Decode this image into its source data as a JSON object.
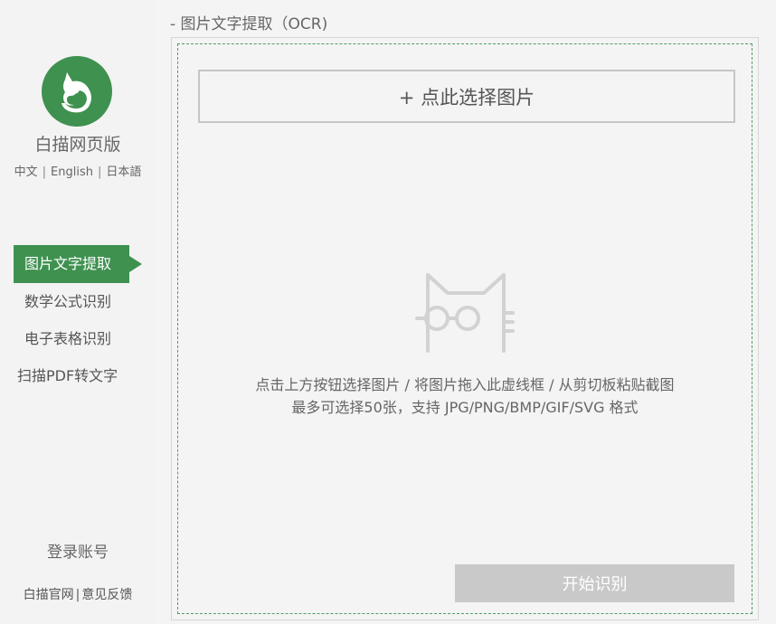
{
  "sidebar": {
    "brand": "白描网页版",
    "languages": [
      "中文",
      "English",
      "日本語"
    ],
    "nav": [
      {
        "label": "图片文字提取",
        "active": true
      },
      {
        "label": "数学公式识别",
        "active": false
      },
      {
        "label": "电子表格识别",
        "active": false
      },
      {
        "label": "扫描PDF转文字",
        "active": false
      }
    ],
    "login": "登录账号",
    "footer": {
      "official_site": "白描官网",
      "separator": "|",
      "feedback": "意见反馈"
    }
  },
  "main": {
    "title": "- 图片文字提取（OCR)",
    "select_button": "+ 点此选择图片",
    "hint_line1": "点击上方按钮选择图片 / 将图片拖入此虚线框 / 从剪切板粘贴截图",
    "hint_line2": "最多可选择50张，支持 JPG/PNG/BMP/GIF/SVG 格式",
    "start_button": "开始识别"
  },
  "colors": {
    "accent": "#3f9150",
    "dashed_border": "#4f9d68",
    "disabled_button": "#c9c9c9"
  },
  "icons": {
    "logo": "squirrel-logo-icon",
    "empty_state": "cat-with-glasses-icon"
  }
}
